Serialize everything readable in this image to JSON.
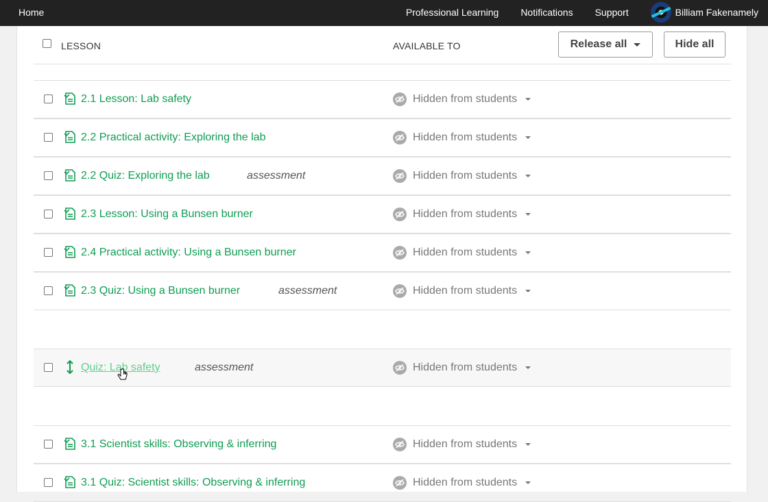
{
  "topbar": {
    "home": "Home",
    "nav": [
      "Professional Learning",
      "Notifications",
      "Support"
    ],
    "user_name": "Billiam Fakenamely"
  },
  "header": {
    "lesson_col": "LESSON",
    "available_col": "AVAILABLE TO",
    "release_all": "Release all",
    "hide_all": "Hide all"
  },
  "rows": [
    {
      "title": "2.1 Lesson: Lab safety",
      "tag": "",
      "visibility": "Hidden from students"
    },
    {
      "title": "2.2 Practical activity: Exploring the lab",
      "tag": "",
      "visibility": "Hidden from students"
    },
    {
      "title": "2.2 Quiz: Exploring the lab",
      "tag": "assessment",
      "visibility": "Hidden from students"
    },
    {
      "title": "2.3 Lesson: Using a Bunsen burner",
      "tag": "",
      "visibility": "Hidden from students"
    },
    {
      "title": "2.4 Practical activity: Using a Bunsen burner",
      "tag": "",
      "visibility": "Hidden from students"
    },
    {
      "title": "2.3 Quiz: Using a Bunsen burner",
      "tag": "assessment",
      "visibility": "Hidden from students"
    },
    {
      "title": "Quiz: Lab safety",
      "tag": "assessment",
      "visibility": "Hidden from students"
    },
    {
      "title": "3.1 Scientist skills: Observing & inferring",
      "tag": "",
      "visibility": "Hidden from students"
    },
    {
      "title": "3.1 Quiz: Scientist skills: Observing & inferring",
      "tag": "",
      "visibility": "Hidden from students"
    }
  ],
  "colors": {
    "link_green": "#0f9c52",
    "topbar": "#222222",
    "muted": "#777777"
  }
}
